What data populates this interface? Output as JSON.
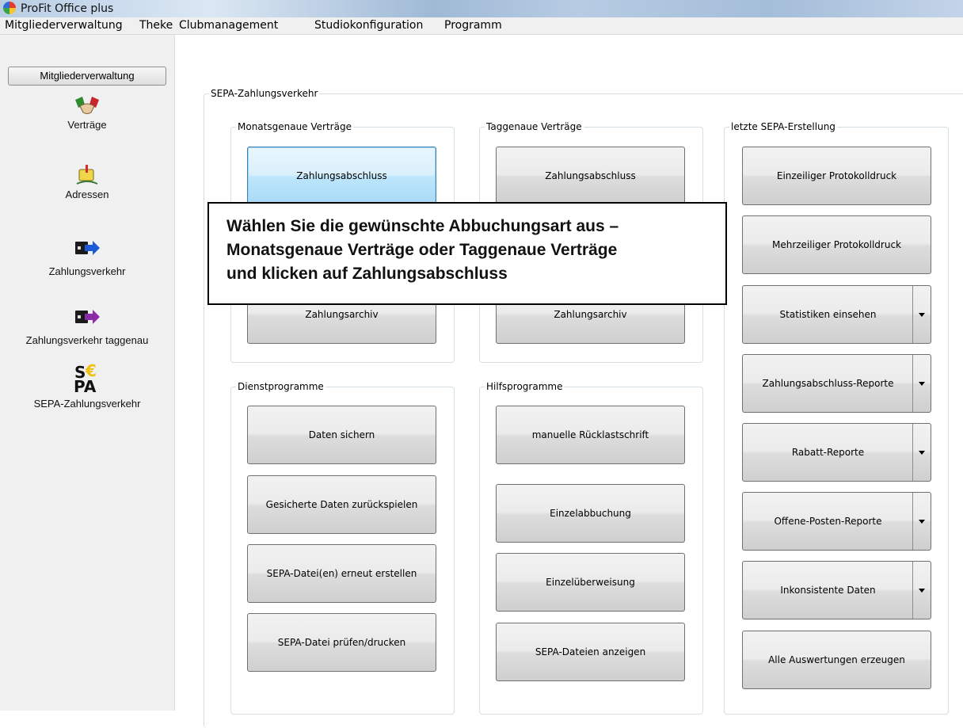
{
  "window": {
    "title": "ProFit Office plus"
  },
  "menu": [
    "Mitgliederverwaltung",
    "Theke",
    "Clubmanagement",
    "Studiokonfiguration",
    "Programm"
  ],
  "sidebar": {
    "header": "Mitgliederverwaltung",
    "items": [
      {
        "label": "Verträge",
        "icon": "handshake-icon"
      },
      {
        "label": "Adressen",
        "icon": "mailbox-icon"
      },
      {
        "label": "Zahlungsverkehr",
        "icon": "card-transfer-icon"
      },
      {
        "label": "Zahlungsverkehr taggenau",
        "icon": "card-transfer-daily-icon"
      },
      {
        "label": "SEPA-Zahlungsverkehr",
        "icon": "sepa-logo-icon",
        "logo_text": [
          "S",
          "€",
          "PA"
        ]
      }
    ]
  },
  "main": {
    "title": "SEPA-Zahlungsverkehr",
    "monatsgenau": {
      "title": "Monatsgenaue Verträge",
      "buttons": [
        "Zahlungsabschluss",
        "Zahlungsarchiv"
      ]
    },
    "taggenau": {
      "title": "Taggenaue Verträge",
      "buttons": [
        "Zahlungsabschluss",
        "Zahlungsarchiv"
      ]
    },
    "letzte": {
      "title": "letzte SEPA-Erstellung",
      "buttons": [
        "Einzeiliger Protokolldruck",
        "Mehrzeiliger Protokolldruck"
      ],
      "splits": [
        "Statistiken einsehen",
        "Zahlungsabschluss-Reporte",
        "Rabatt-Reporte",
        "Offene-Posten-Reporte",
        "Inkonsistente Daten"
      ],
      "last_button": "Alle Auswertungen erzeugen"
    },
    "dienst": {
      "title": "Dienstprogramme",
      "buttons": [
        "Daten sichern",
        "Gesicherte Daten zurückspielen",
        "SEPA-Datei(en) erneut erstellen",
        "SEPA-Datei prüfen/drucken"
      ]
    },
    "hilfs": {
      "title": "Hilfsprogramme",
      "buttons": [
        "manuelle Rücklastschrift",
        "Einzelabbuchung",
        "Einzelüberweisung",
        "SEPA-Dateien anzeigen"
      ]
    }
  },
  "callout": {
    "lines": [
      "Wählen Sie die gewünschte Abbuchungsart aus –",
      "Monatsgenaue Verträge oder Taggenaue Verträge",
      "und klicken auf Zahlungsabschluss"
    ]
  },
  "colors": {
    "accent": "#3c7fb1",
    "group_border": "#d5dfe5"
  }
}
